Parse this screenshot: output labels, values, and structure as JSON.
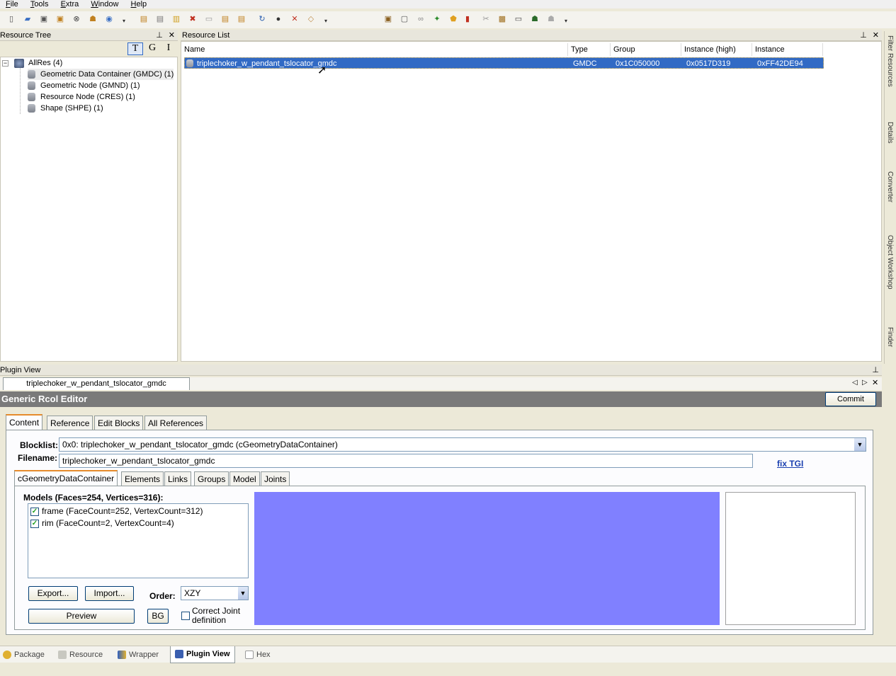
{
  "menu": [
    "File",
    "Tools",
    "Extra",
    "Window",
    "Help"
  ],
  "resource_tree": {
    "title": "Resource Tree",
    "filter_buttons": [
      "T",
      "G",
      "I"
    ],
    "root": "AllRes (4)",
    "items": [
      "Geometric Data Container (GMDC) (1)",
      "Geometric Node (GMND) (1)",
      "Resource Node (CRES) (1)",
      "Shape (SHPE) (1)"
    ]
  },
  "resource_list": {
    "title": "Resource List",
    "columns": [
      "Name",
      "Type",
      "Group",
      "Instance (high)",
      "Instance"
    ],
    "rows": [
      {
        "name": "triplechoker_w_pendant_tslocator_gmdc",
        "type": "GMDC",
        "group": "0x1C050000",
        "instance_high": "0x0517D319",
        "instance": "0xFF42DE94"
      }
    ]
  },
  "side_tabs": [
    "Filter Resources",
    "Details",
    "Converter",
    "Object Workshop",
    "Finder"
  ],
  "plugin_view": {
    "title": "Plugin View",
    "doc_tab": "triplechoker_w_pendant_tslocator_gmdc",
    "editor_title": "Generic Rcol Editor",
    "commit_label": "Commit",
    "tabs": [
      "Content",
      "Reference",
      "Edit Blocks",
      "All References"
    ],
    "blocklist_label": "Blocklist:",
    "blocklist_value": "0x0: triplechoker_w_pendant_tslocator_gmdc (cGeometryDataContainer)",
    "filename_label": "Filename:",
    "filename_value": "triplechoker_w_pendant_tslocator_gmdc",
    "fix_tgi": "fix TGI",
    "subtabs": [
      "cGeometryDataContainer",
      "Elements",
      "Links",
      "Groups",
      "Model",
      "Joints"
    ],
    "models_label": "Models (Faces=254, Vertices=316):",
    "models": [
      {
        "label": "frame (FaceCount=252, VertexCount=312)",
        "checked": true
      },
      {
        "label": "rim (FaceCount=2, VertexCount=4)",
        "checked": true
      }
    ],
    "export_label": "Export...",
    "import_label": "Import...",
    "order_label": "Order:",
    "order_value": "XZY",
    "preview_label": "Preview",
    "bg_label": "BG",
    "correct_joint_label_1": "Correct Joint",
    "correct_joint_label_2": "definition",
    "preview_color": "#8080ff"
  },
  "bottom_tabs": [
    "Package",
    "Resource",
    "Wrapper",
    "Plugin View",
    "Hex"
  ],
  "active_bottom_tab": "Plugin View",
  "colors": {
    "selection": "#316ac5",
    "header_dark": "#7a7a7a"
  }
}
